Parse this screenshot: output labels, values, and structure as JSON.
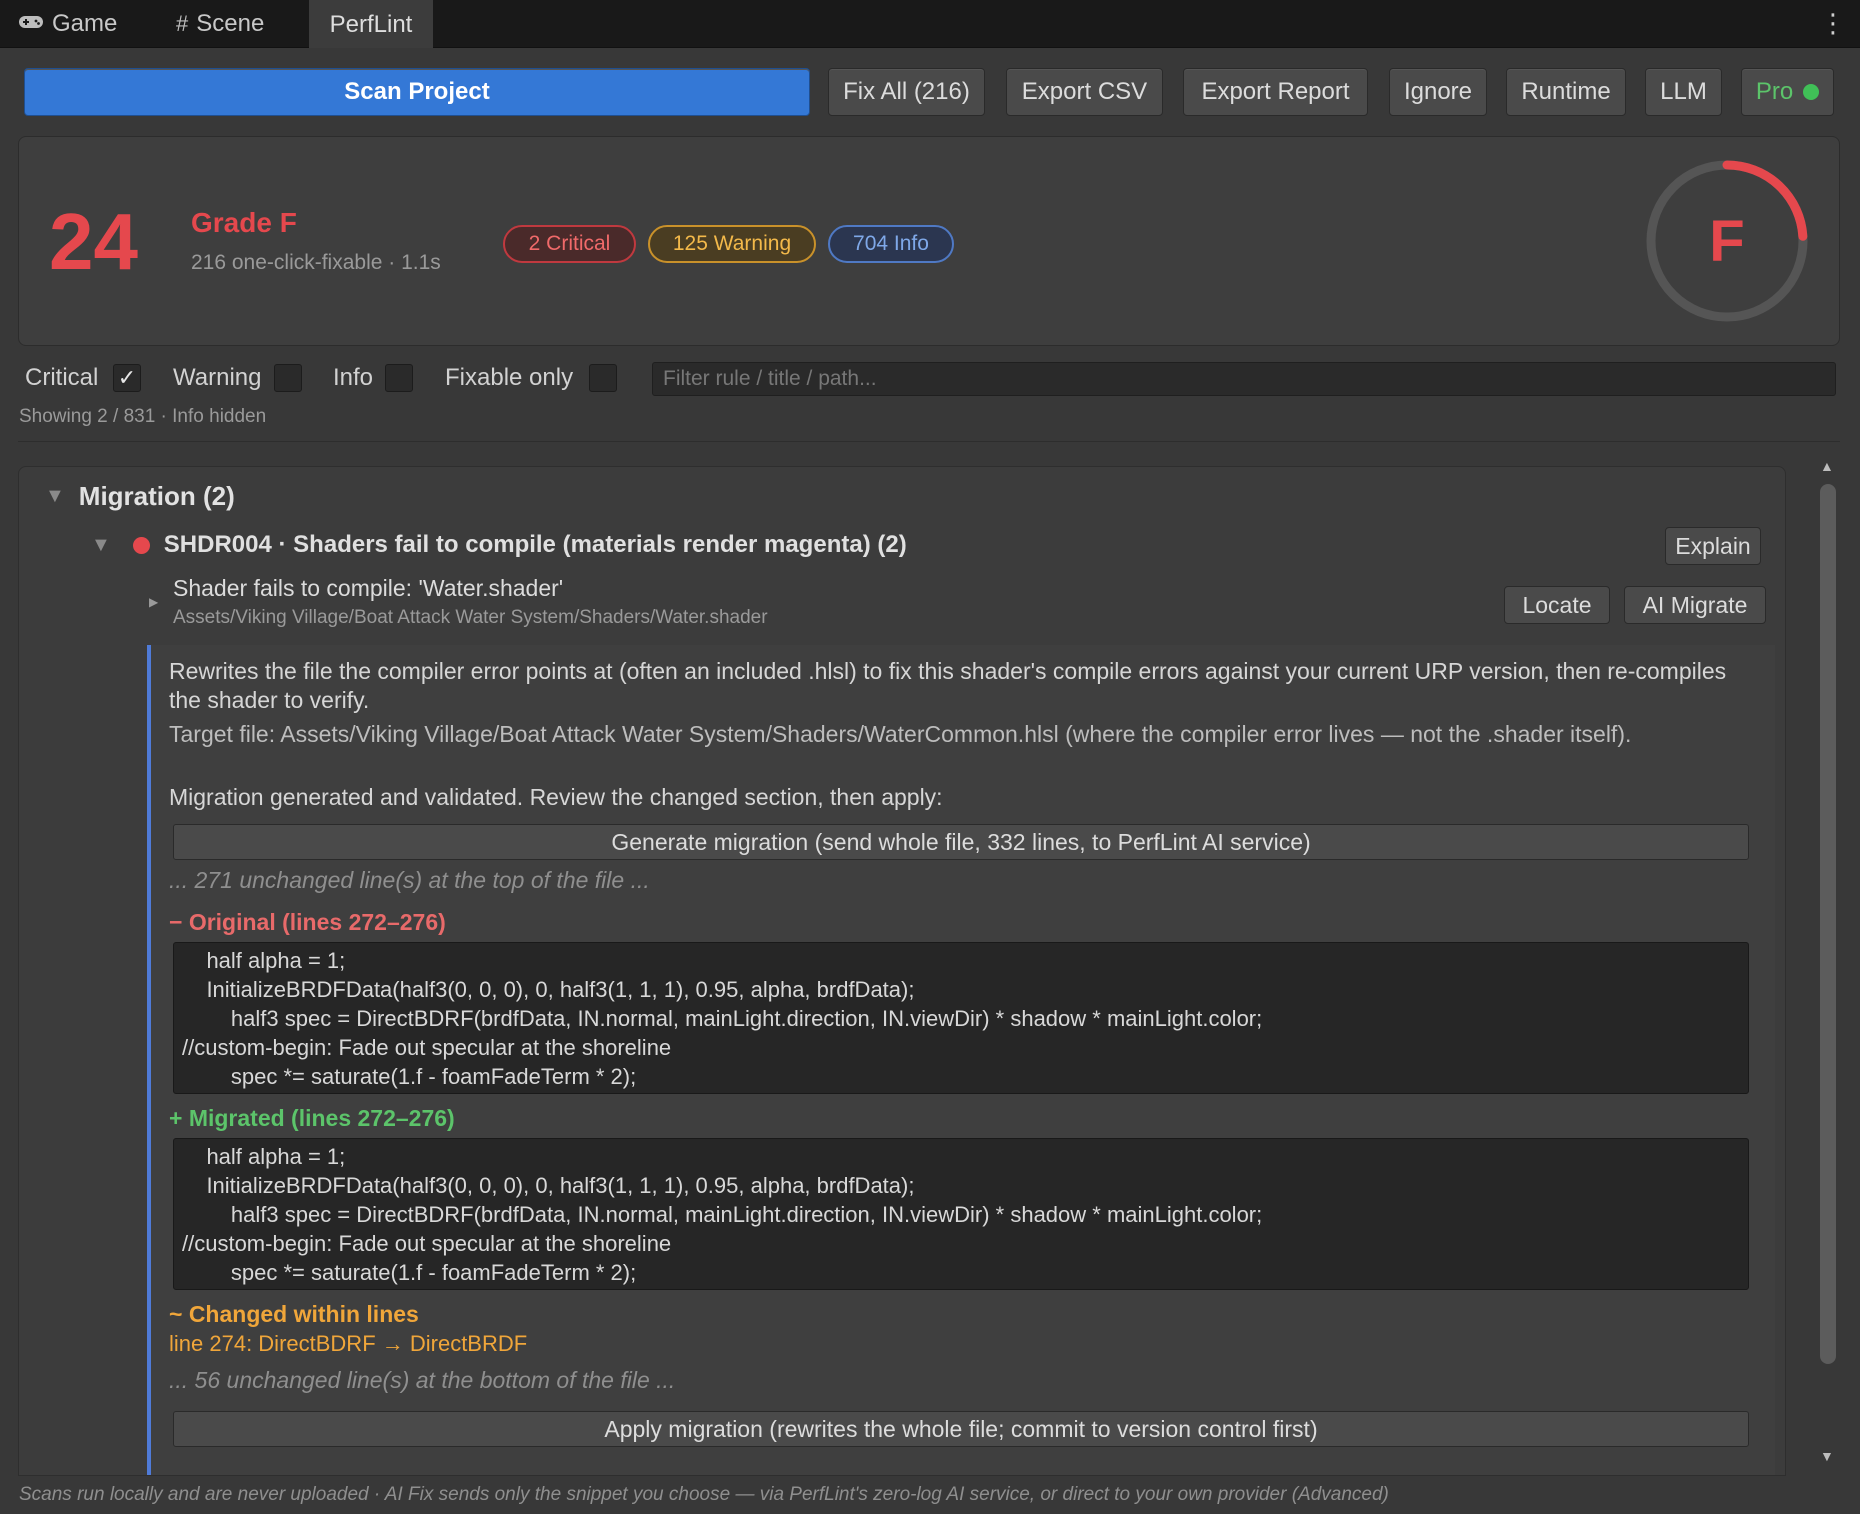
{
  "tabs": [
    {
      "label": "Game",
      "icon": "gamepad-icon"
    },
    {
      "label": "Scene",
      "icon": "grid-icon"
    },
    {
      "label": "PerfLint",
      "active": true
    }
  ],
  "toolbar": {
    "scan": "Scan Project",
    "fix_all": "Fix All (216)",
    "export_csv": "Export CSV",
    "export_report": "Export Report",
    "ignore": "Ignore",
    "runtime": "Runtime",
    "llm": "LLM",
    "pro": "Pro",
    "pro_status_color": "#40c057"
  },
  "score": {
    "value": "24",
    "grade_label": "Grade F",
    "sub": "216 one-click-fixable · 1.1s",
    "critical": "2 Critical",
    "warning": "125 Warning",
    "info": "704 Info",
    "gauge_letter": "F",
    "gauge_fraction": 0.24,
    "color": "#e5484d"
  },
  "filters": {
    "critical": {
      "label": "Critical",
      "checked": true
    },
    "warning": {
      "label": "Warning",
      "checked": false
    },
    "info": {
      "label": "Info",
      "checked": false
    },
    "fixable": {
      "label": "Fixable only",
      "checked": false
    },
    "placeholder": "Filter rule / title / path...",
    "showing": "Showing 2 / 831 · Info hidden"
  },
  "group": {
    "title": "Migration (2)",
    "rule": {
      "title": "SHDR004 · Shaders fail to compile (materials render magenta) (2)",
      "explain": "Explain",
      "finding": {
        "title": "Shader fails to compile: 'Water.shader'",
        "path": "Assets/Viking Village/Boat Attack Water System/Shaders/Water.shader",
        "locate": "Locate",
        "ai_migrate": "AI Migrate"
      },
      "detail": {
        "description": "Rewrites the file the compiler error points at (often an included .hlsl) to fix this shader's compile errors against your current URP version, then re-compiles the shader to verify.",
        "target": "Target file: Assets/Viking Village/Boat Attack Water System/Shaders/WaterCommon.hlsl (where the compiler error lives — not the .shader itself).",
        "status": "Migration generated and validated. Review the changed section, then apply:",
        "generate_button": "Generate migration (send whole file, 332 lines, to PerfLint AI service)",
        "top_unchanged": "... 271 unchanged line(s) at the top of the file ...",
        "original_header": "− Original (lines 272–276)",
        "original_lines": [
          "    half alpha = 1;",
          "    InitializeBRDFData(half3(0, 0, 0), 0, half3(1, 1, 1), 0.95, alpha, brdfData);",
          "        half3 spec = DirectBDRF(brdfData, IN.normal, mainLight.direction, IN.viewDir) * shadow * mainLight.color;",
          "//custom-begin: Fade out specular at the shoreline",
          "        spec *= saturate(1.f - foamFadeTerm * 2);"
        ],
        "migrated_header": "+ Migrated (lines 272–276)",
        "migrated_lines": [
          "    half alpha = 1;",
          "    InitializeBRDFData(half3(0, 0, 0), 0, half3(1, 1, 1), 0.95, alpha, brdfData);",
          "        half3 spec = DirectBDRF(brdfData, IN.normal, mainLight.direction, IN.viewDir) * shadow * mainLight.color;",
          "//custom-begin: Fade out specular at the shoreline",
          "        spec *= saturate(1.f - foamFadeTerm * 2);"
        ],
        "changed_header": "~ Changed within lines",
        "changed_line": "line 274: DirectBDRF → DirectBRDF",
        "bottom_unchanged": "... 56 unchanged line(s) at the bottom of the file ...",
        "apply_button": "Apply migration (rewrites the whole file; commit to version control first)"
      }
    }
  },
  "footer": "Scans run locally and are never uploaded · AI Fix sends only the snippet you choose — via PerfLint's zero-log AI service, or direct to your own provider (Advanced)"
}
